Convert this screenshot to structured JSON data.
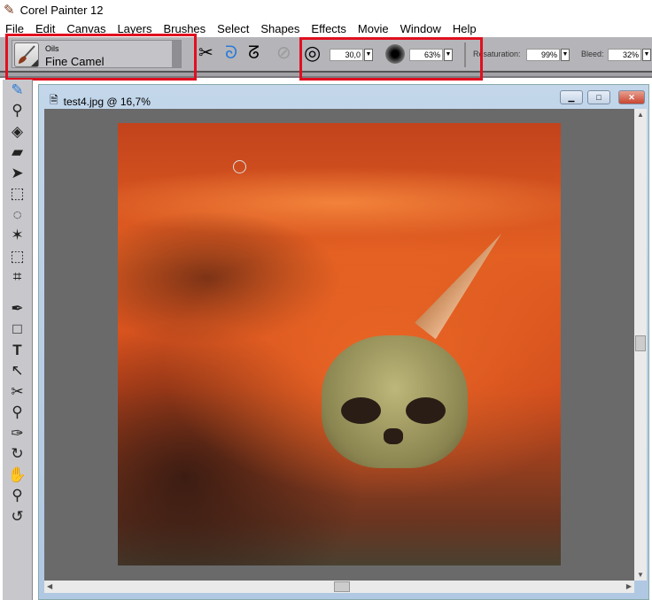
{
  "app": {
    "title": "Corel Painter 12",
    "icon": "painter-brush-icon"
  },
  "menu": [
    "File",
    "Edit",
    "Canvas",
    "Layers",
    "Brushes",
    "Select",
    "Shapes",
    "Effects",
    "Movie",
    "Window",
    "Help"
  ],
  "property_bar": {
    "brush_category": "Oils",
    "brush_variant": "Fine Camel",
    "size_value": "30,0",
    "opacity_value": "63%",
    "resaturation_label": "Resaturation:",
    "resaturation_value": "99%",
    "bleed_label": "Bleed:",
    "bleed_value": "32%"
  },
  "highlight_color": "#e01020",
  "toolbox": [
    "brush",
    "dropper",
    "paint-bucket",
    "eraser",
    "layer-adjuster",
    "rect-select",
    "lasso",
    "magic-wand",
    "transform",
    "crop",
    "pen",
    "rectangle",
    "text",
    "shape-selection",
    "cloner",
    "rubber-stamp",
    "dodge",
    "burn",
    "grabber",
    "magnifier",
    "rotate-page"
  ],
  "document": {
    "title": "test4.jpg @ 16,7%",
    "minimize": "▁",
    "maximize": "□",
    "close": "✕"
  }
}
